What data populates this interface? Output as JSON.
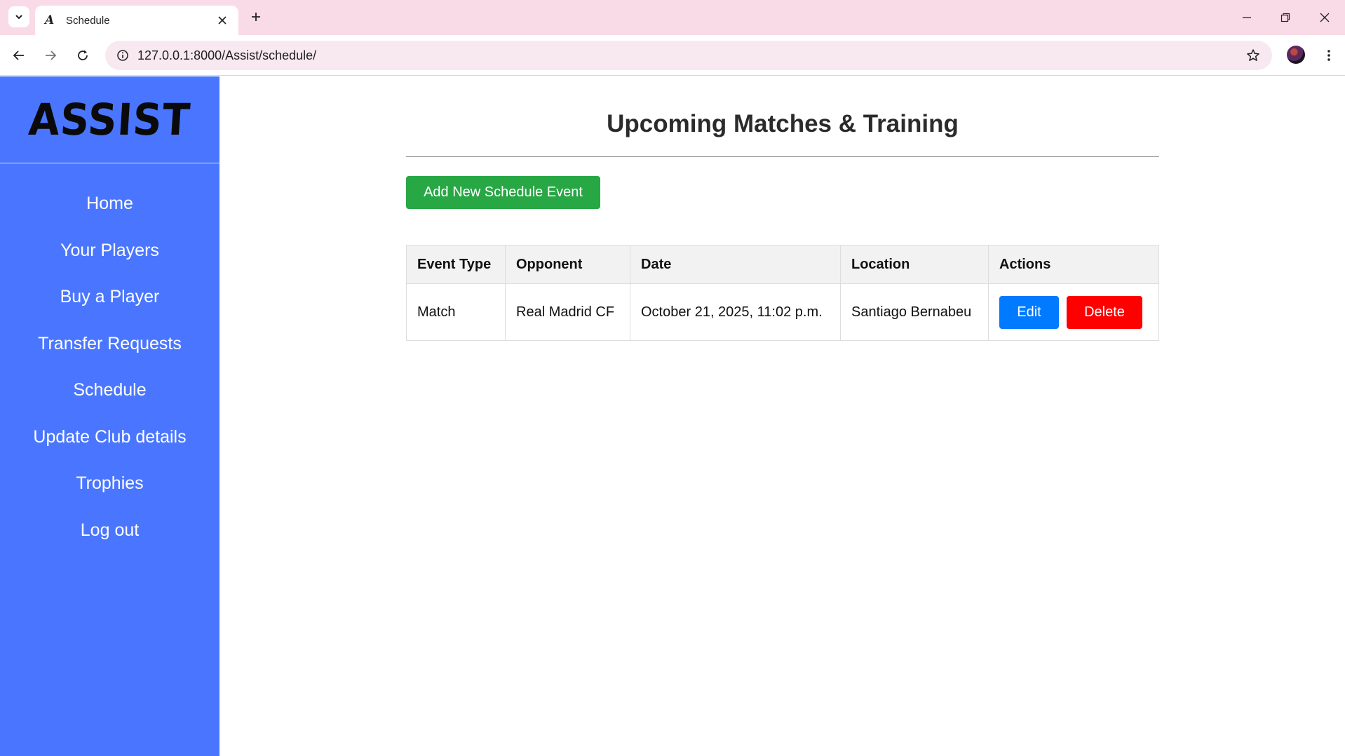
{
  "browser": {
    "tab_title": "Schedule",
    "tab_favicon": "A",
    "url": "127.0.0.1:8000/Assist/schedule/"
  },
  "sidebar": {
    "logo": "ASSIST",
    "items": [
      {
        "label": "Home"
      },
      {
        "label": "Your Players"
      },
      {
        "label": "Buy a Player"
      },
      {
        "label": "Transfer Requests"
      },
      {
        "label": "Schedule"
      },
      {
        "label": "Update Club details"
      },
      {
        "label": "Trophies"
      },
      {
        "label": "Log out"
      }
    ]
  },
  "main": {
    "title": "Upcoming Matches & Training",
    "add_button": "Add New Schedule Event",
    "table": {
      "headers": [
        "Event Type",
        "Opponent",
        "Date",
        "Location",
        "Actions"
      ],
      "rows": [
        {
          "event_type": "Match",
          "opponent": "Real Madrid CF",
          "date": "October 21, 2025, 11:02 p.m.",
          "location": "Santiago Bernabeu",
          "edit_label": "Edit",
          "delete_label": "Delete"
        }
      ]
    }
  },
  "colors": {
    "sidebar_bg": "#4a76ff",
    "add_button": "#28a745",
    "edit_button": "#007bff",
    "delete_button": "#ff0000",
    "tabbar_bg": "#f9dbe8"
  }
}
